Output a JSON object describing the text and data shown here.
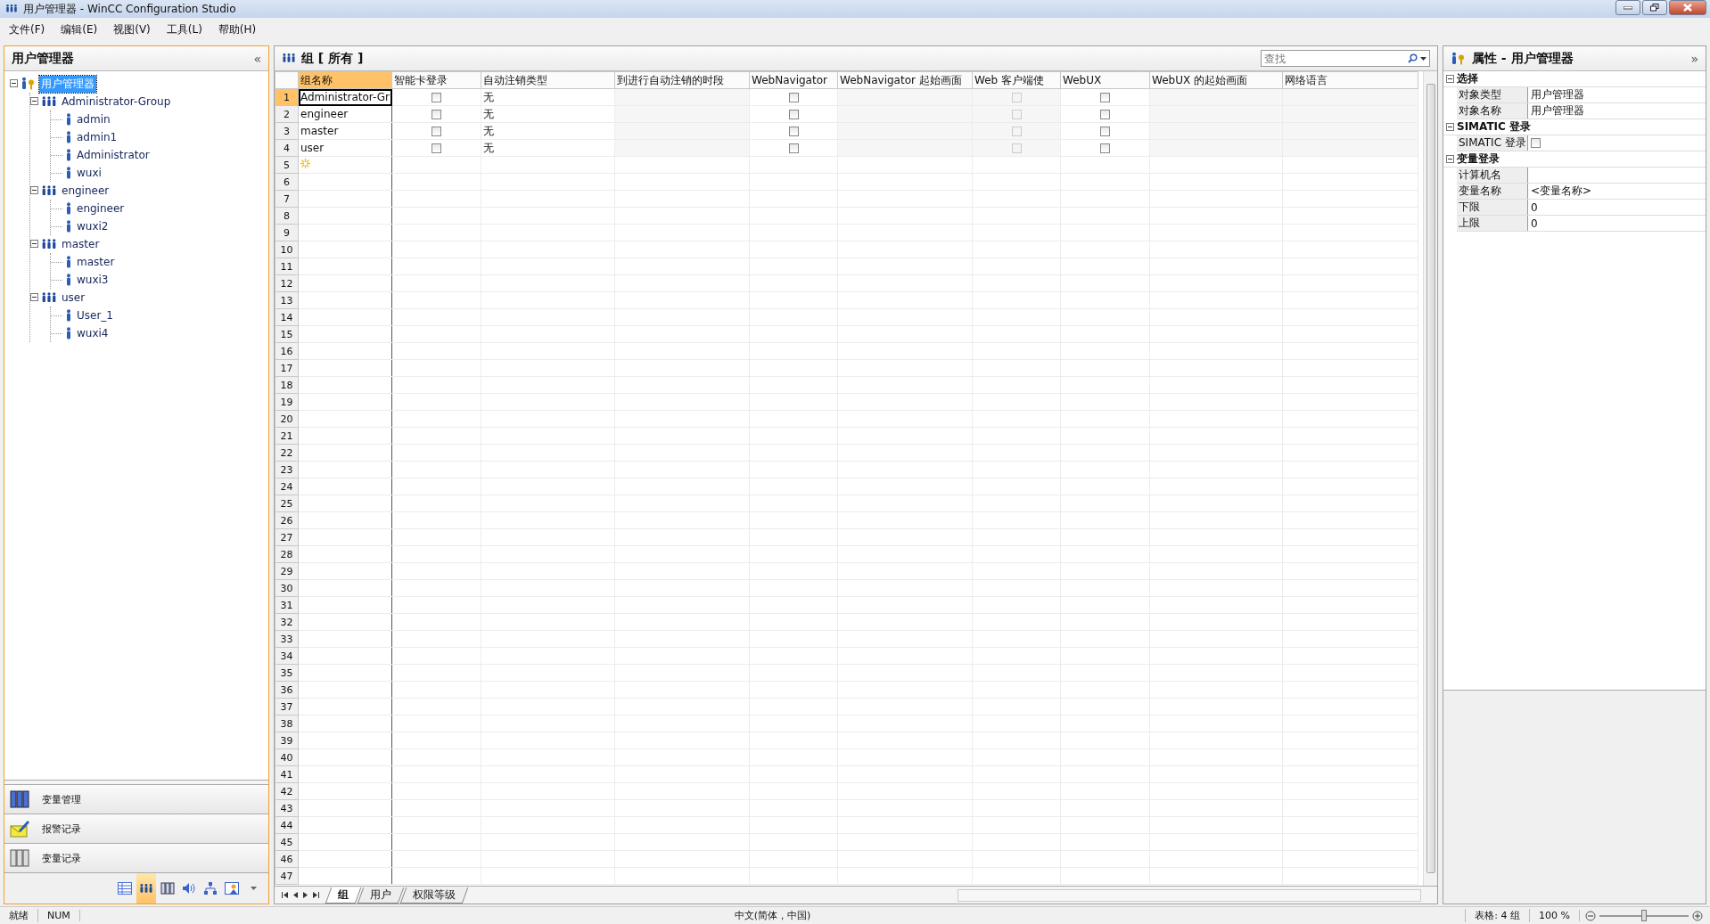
{
  "window": {
    "title": "用户管理器 - WinCC Configuration Studio"
  },
  "menu": [
    "文件(F)",
    "编辑(E)",
    "视图(V)",
    "工具(L)",
    "帮助(H)"
  ],
  "navigation": {
    "title": "用户管理器",
    "collapse_glyph": "«",
    "tree": [
      {
        "label": "用户管理器",
        "kind": "root",
        "selected": true,
        "expanded": true,
        "children": [
          {
            "label": "Administrator-Group",
            "kind": "group",
            "selected": false,
            "expanded": true,
            "children": [
              {
                "label": "admin",
                "kind": "user",
                "selected": false
              },
              {
                "label": "admin1",
                "kind": "user",
                "selected": false
              },
              {
                "label": "Administrator",
                "kind": "user",
                "selected": false
              },
              {
                "label": "wuxi",
                "kind": "user",
                "selected": false
              }
            ]
          },
          {
            "label": "engineer",
            "kind": "group",
            "selected": false,
            "expanded": true,
            "children": [
              {
                "label": "engineer",
                "kind": "user",
                "selected": false
              },
              {
                "label": "wuxi2",
                "kind": "user",
                "selected": false
              }
            ]
          },
          {
            "label": "master",
            "kind": "group",
            "selected": false,
            "expanded": true,
            "children": [
              {
                "label": "master",
                "kind": "user",
                "selected": false
              },
              {
                "label": "wuxi3",
                "kind": "user",
                "selected": false
              }
            ]
          },
          {
            "label": "user",
            "kind": "group",
            "selected": false,
            "expanded": true,
            "children": [
              {
                "label": "User_1",
                "kind": "user",
                "selected": false
              },
              {
                "label": "wuxi4",
                "kind": "user",
                "selected": false
              }
            ]
          }
        ]
      }
    ],
    "editors": [
      {
        "label": "变量管理",
        "kind": "tags"
      },
      {
        "label": "报警记录",
        "kind": "alarm"
      },
      {
        "label": "变量记录",
        "kind": "archive"
      }
    ],
    "editor_icons": [
      {
        "kind": "table",
        "selected": false
      },
      {
        "kind": "users",
        "selected": true
      },
      {
        "kind": "archive",
        "selected": false
      },
      {
        "kind": "sound",
        "selected": false
      },
      {
        "kind": "tree",
        "selected": false
      },
      {
        "kind": "list",
        "selected": false
      }
    ]
  },
  "editor": {
    "title": "组 [ 所有 ]",
    "search": {
      "placeholder": "查找"
    },
    "columns": [
      {
        "label": "组名称",
        "selected": true
      },
      {
        "label": "智能卡登录",
        "selected": false
      },
      {
        "label": "自动注销类型",
        "selected": false
      },
      {
        "label": "到进行自动注销的时段",
        "selected": false
      },
      {
        "label": "WebNavigator",
        "selected": false
      },
      {
        "label": "WebNavigator 起始画面",
        "selected": false
      },
      {
        "label": "Web 客户端使",
        "selected": false
      },
      {
        "label": "WebUX",
        "selected": false
      },
      {
        "label": "WebUX 的起始画面",
        "selected": false
      },
      {
        "label": "网络语言",
        "selected": false
      }
    ],
    "rows": [
      {
        "number": "1",
        "kind": "data",
        "selected": true,
        "cells": [
          {
            "kind": "text",
            "text": "Administrator-Gr"
          },
          {
            "kind": "check",
            "checked": false
          },
          {
            "kind": "text",
            "text": "无"
          },
          {
            "kind": "blank"
          },
          {
            "kind": "check",
            "checked": false
          },
          {
            "kind": "blank"
          },
          {
            "kind": "check_disabled",
            "checked": false
          },
          {
            "kind": "check",
            "checked": false
          },
          {
            "kind": "blank"
          },
          {
            "kind": "blank"
          }
        ]
      },
      {
        "number": "2",
        "kind": "data",
        "selected": false,
        "cells": [
          {
            "kind": "text",
            "text": "engineer"
          },
          {
            "kind": "check",
            "checked": false
          },
          {
            "kind": "text",
            "text": "无"
          },
          {
            "kind": "blank"
          },
          {
            "kind": "check",
            "checked": false
          },
          {
            "kind": "blank"
          },
          {
            "kind": "check_disabled",
            "checked": false
          },
          {
            "kind": "check",
            "checked": false
          },
          {
            "kind": "blank"
          },
          {
            "kind": "blank"
          }
        ]
      },
      {
        "number": "3",
        "kind": "data",
        "selected": false,
        "cells": [
          {
            "kind": "text",
            "text": "master"
          },
          {
            "kind": "check",
            "checked": false
          },
          {
            "kind": "text",
            "text": "无"
          },
          {
            "kind": "blank"
          },
          {
            "kind": "check",
            "checked": false
          },
          {
            "kind": "blank"
          },
          {
            "kind": "check_disabled",
            "checked": false
          },
          {
            "kind": "check",
            "checked": false
          },
          {
            "kind": "blank"
          },
          {
            "kind": "blank"
          }
        ]
      },
      {
        "number": "4",
        "kind": "data",
        "selected": false,
        "cells": [
          {
            "kind": "text",
            "text": "user"
          },
          {
            "kind": "check",
            "checked": false
          },
          {
            "kind": "text",
            "text": "无"
          },
          {
            "kind": "blank"
          },
          {
            "kind": "check",
            "checked": false
          },
          {
            "kind": "blank"
          },
          {
            "kind": "check_disabled",
            "checked": false
          },
          {
            "kind": "check",
            "checked": false
          },
          {
            "kind": "blank"
          },
          {
            "kind": "blank"
          }
        ]
      },
      {
        "number": "5",
        "kind": "new",
        "selected": false
      },
      {
        "number": "6",
        "kind": "empty",
        "selected": false
      },
      {
        "number": "7",
        "kind": "empty",
        "selected": false
      },
      {
        "number": "8",
        "kind": "empty",
        "selected": false
      },
      {
        "number": "9",
        "kind": "empty",
        "selected": false
      },
      {
        "number": "10",
        "kind": "empty",
        "selected": false
      },
      {
        "number": "11",
        "kind": "empty",
        "selected": false
      },
      {
        "number": "12",
        "kind": "empty",
        "selected": false
      },
      {
        "number": "13",
        "kind": "empty",
        "selected": false
      },
      {
        "number": "14",
        "kind": "empty",
        "selected": false
      },
      {
        "number": "15",
        "kind": "empty",
        "selected": false
      },
      {
        "number": "16",
        "kind": "empty",
        "selected": false
      },
      {
        "number": "17",
        "kind": "empty",
        "selected": false
      },
      {
        "number": "18",
        "kind": "empty",
        "selected": false
      },
      {
        "number": "19",
        "kind": "empty",
        "selected": false
      },
      {
        "number": "20",
        "kind": "empty",
        "selected": false
      },
      {
        "number": "21",
        "kind": "empty",
        "selected": false
      },
      {
        "number": "22",
        "kind": "empty",
        "selected": false
      },
      {
        "number": "23",
        "kind": "empty",
        "selected": false
      },
      {
        "number": "24",
        "kind": "empty",
        "selected": false
      },
      {
        "number": "25",
        "kind": "empty",
        "selected": false
      },
      {
        "number": "26",
        "kind": "empty",
        "selected": false
      },
      {
        "number": "27",
        "kind": "empty",
        "selected": false
      },
      {
        "number": "28",
        "kind": "empty",
        "selected": false
      },
      {
        "number": "29",
        "kind": "empty",
        "selected": false
      },
      {
        "number": "30",
        "kind": "empty",
        "selected": false
      },
      {
        "number": "31",
        "kind": "empty",
        "selected": false
      },
      {
        "number": "32",
        "kind": "empty",
        "selected": false
      },
      {
        "number": "33",
        "kind": "empty",
        "selected": false
      },
      {
        "number": "34",
        "kind": "empty",
        "selected": false
      },
      {
        "number": "35",
        "kind": "empty",
        "selected": false
      },
      {
        "number": "36",
        "kind": "empty",
        "selected": false
      },
      {
        "number": "37",
        "kind": "empty",
        "selected": false
      },
      {
        "number": "38",
        "kind": "empty",
        "selected": false
      },
      {
        "number": "39",
        "kind": "empty",
        "selected": false
      },
      {
        "number": "40",
        "kind": "empty",
        "selected": false
      },
      {
        "number": "41",
        "kind": "empty",
        "selected": false
      },
      {
        "number": "42",
        "kind": "empty",
        "selected": false
      },
      {
        "number": "43",
        "kind": "empty",
        "selected": false
      },
      {
        "number": "44",
        "kind": "empty",
        "selected": false
      },
      {
        "number": "45",
        "kind": "empty",
        "selected": false
      },
      {
        "number": "46",
        "kind": "empty",
        "selected": false
      },
      {
        "number": "47",
        "kind": "empty",
        "selected": false
      }
    ],
    "sheet_tabs": [
      {
        "label": "组",
        "selected": true
      },
      {
        "label": "用户",
        "selected": false
      },
      {
        "label": "权限等级",
        "selected": false
      }
    ]
  },
  "properties": {
    "title": "属性 - 用户管理器",
    "expand_glyph": "»",
    "sections": [
      {
        "label": "选择",
        "expanded": true,
        "rows": [
          {
            "name": "对象类型",
            "value": "用户管理器"
          },
          {
            "name": "对象名称",
            "value": "用户管理器"
          }
        ]
      },
      {
        "label": "SIMATIC 登录",
        "expanded": true,
        "rows": [
          {
            "name": "SIMATIC 登录",
            "kind": "check",
            "checked": false
          }
        ]
      },
      {
        "label": "变量登录",
        "expanded": true,
        "rows": [
          {
            "name": "计算机名"
          },
          {
            "name": "变量名称",
            "value": "<变量名称>"
          },
          {
            "name": "下限",
            "value": "0"
          },
          {
            "name": "上限",
            "value": "0"
          }
        ]
      }
    ]
  },
  "status_bar": {
    "state": "就绪",
    "num": "NUM",
    "language": "中文(简体，中国)",
    "count": "表格: 4 组",
    "zoom": "100 %",
    "zoom_slider": {
      "level": 0.5
    }
  }
}
